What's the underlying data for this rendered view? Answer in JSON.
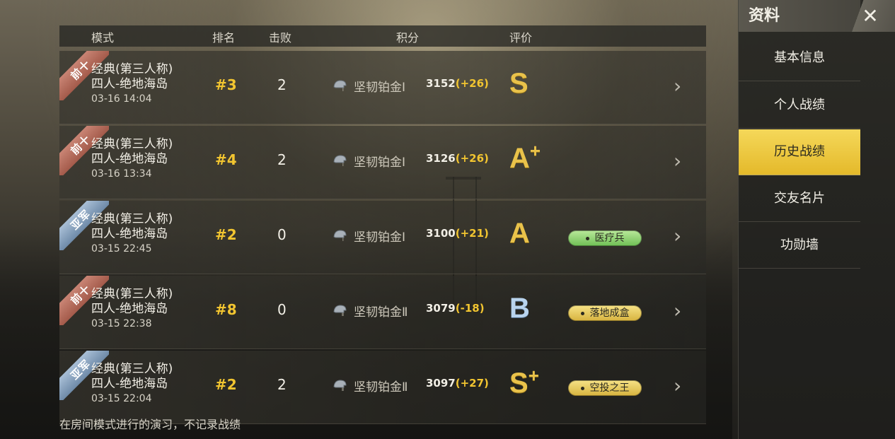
{
  "header": {
    "col_mode": "模式",
    "col_rank": "排名",
    "col_kills": "击败",
    "col_score": "积分",
    "col_grade": "评价"
  },
  "rows": [
    {
      "ribbon": "前十",
      "ribbon_color": "red",
      "mode_line1": "经典(第三人称)",
      "mode_line2": "四人-绝地海岛",
      "time": "03-16 14:04",
      "rank": "#3",
      "kills": "2",
      "tier": "坚韧铂金Ⅰ",
      "score": "3152",
      "delta": "(+26)",
      "grade": "S",
      "grade_plus": "",
      "grade_color": "gold",
      "badge": "",
      "badge_color": ""
    },
    {
      "ribbon": "前十",
      "ribbon_color": "red",
      "mode_line1": "经典(第三人称)",
      "mode_line2": "四人-绝地海岛",
      "time": "03-16 13:34",
      "rank": "#4",
      "kills": "2",
      "tier": "坚韧铂金Ⅰ",
      "score": "3126",
      "delta": "(+26)",
      "grade": "A",
      "grade_plus": "+",
      "grade_color": "gold",
      "badge": "",
      "badge_color": ""
    },
    {
      "ribbon": "亚军",
      "ribbon_color": "blue",
      "mode_line1": "经典(第三人称)",
      "mode_line2": "四人-绝地海岛",
      "time": "03-15 22:45",
      "rank": "#2",
      "kills": "0",
      "tier": "坚韧铂金Ⅰ",
      "score": "3100",
      "delta": "(+21)",
      "grade": "A",
      "grade_plus": "",
      "grade_color": "gold",
      "badge": "医疗兵",
      "badge_color": "green"
    },
    {
      "ribbon": "前十",
      "ribbon_color": "red",
      "mode_line1": "经典(第三人称)",
      "mode_line2": "四人-绝地海岛",
      "time": "03-15 22:38",
      "rank": "#8",
      "kills": "0",
      "tier": "坚韧铂金Ⅱ",
      "score": "3079",
      "delta": "(-18)",
      "grade": "B",
      "grade_plus": "",
      "grade_color": "blue",
      "badge": "落地成盒",
      "badge_color": "yellow"
    },
    {
      "ribbon": "亚军",
      "ribbon_color": "blue",
      "mode_line1": "经典(第三人称)",
      "mode_line2": "四人-绝地海岛",
      "time": "03-15 22:04",
      "rank": "#2",
      "kills": "2",
      "tier": "坚韧铂金Ⅱ",
      "score": "3097",
      "delta": "(+27)",
      "grade": "S",
      "grade_plus": "+",
      "grade_color": "gold",
      "badge": "空投之王",
      "badge_color": "yellow"
    }
  ],
  "note": "在房间模式进行的演习，不记录战绩",
  "sidebar": {
    "title": "资料",
    "close_icon": "close-icon",
    "items": [
      {
        "label": "基本信息",
        "active": false
      },
      {
        "label": "个人战绩",
        "active": false
      },
      {
        "label": "历史战绩",
        "active": true
      },
      {
        "label": "交友名片",
        "active": false
      },
      {
        "label": "功勋墙",
        "active": false
      }
    ]
  },
  "colors": {
    "accent_gold": "#f2c530",
    "active_tab": "#e4b92a"
  }
}
